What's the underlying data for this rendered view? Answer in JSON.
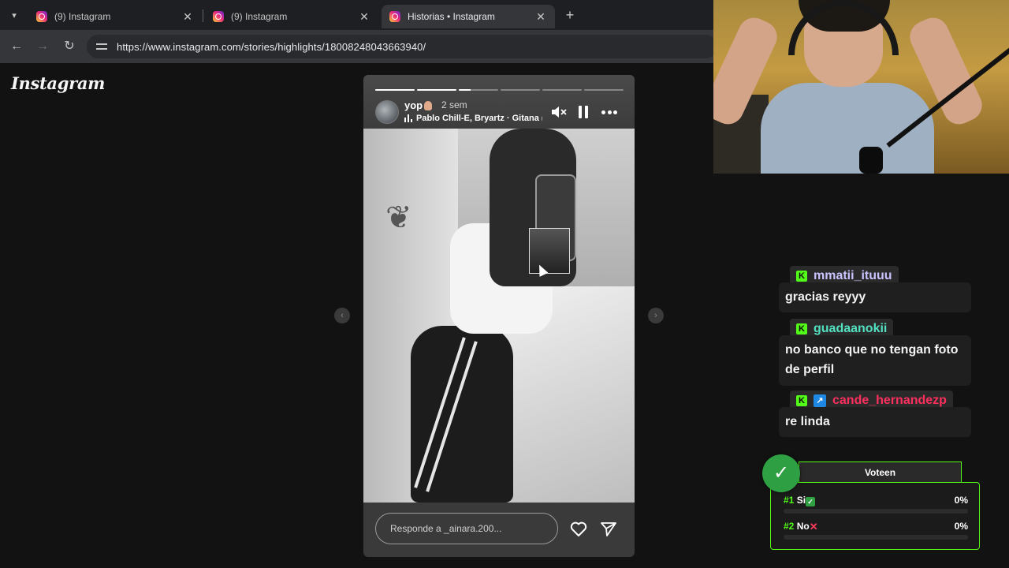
{
  "browser": {
    "tabs": [
      {
        "title": "(9) Instagram",
        "active": false
      },
      {
        "title": "(9) Instagram",
        "active": false
      },
      {
        "title": "Historias • Instagram",
        "active": true
      }
    ],
    "url": "https://www.instagram.com/stories/highlights/18008248043663940/"
  },
  "instagram": {
    "logo": "Instagram",
    "story": {
      "username": "yop",
      "time": "2 sem",
      "song": "Pablo Chill-E, Bryartz · Gitana (I",
      "progress": [
        1,
        1,
        0.3,
        0,
        0,
        0
      ],
      "reply_placeholder": "Responde a _ainara.200..."
    }
  },
  "chat": {
    "messages": [
      {
        "user": "mmatii_ituuu",
        "color": "#c9c3ff",
        "badges": [
          "kick"
        ],
        "text": "gracias reyyy"
      },
      {
        "user": "guadaanokii",
        "color": "#53e0c0",
        "badges": [
          "kick"
        ],
        "text": "no banco que no tengan foto de perfil"
      },
      {
        "user": "cande_hernandezp",
        "color": "#ff2f5e",
        "badges": [
          "kick",
          "sub"
        ],
        "text": "re linda"
      }
    ]
  },
  "poll": {
    "title": "Voteen",
    "options": [
      {
        "num": "#1",
        "label": "Si",
        "emoji": "check",
        "percent": "0%",
        "value": 0
      },
      {
        "num": "#2",
        "label": "No",
        "emoji": "cross",
        "percent": "0%",
        "value": 0
      }
    ]
  },
  "icons": {
    "tab_favicon": "instagram-icon",
    "back": "arrow-left-icon",
    "forward": "arrow-right-icon",
    "reload": "reload-icon",
    "site_info": "site-info-icon",
    "mute": "volume-muted-icon",
    "pause": "pause-icon",
    "more": "more-icon",
    "heart": "heart-icon",
    "send": "send-icon",
    "check": "check-icon"
  }
}
